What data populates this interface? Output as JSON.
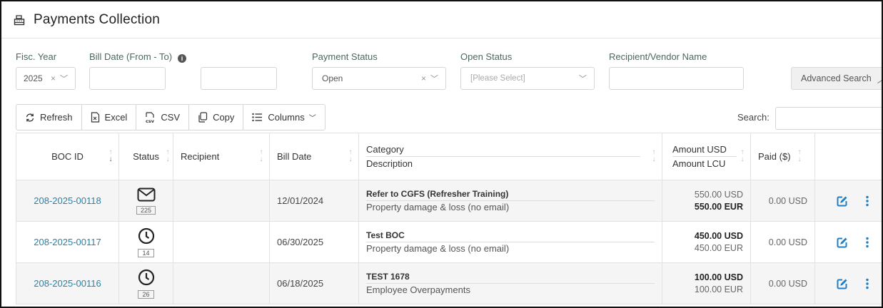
{
  "header": {
    "title": "Payments Collection",
    "icon": "cash-register-icon"
  },
  "filters": {
    "fisc_year": {
      "label": "Fisc. Year",
      "value": "2025"
    },
    "bill_date": {
      "label": "Bill Date (From - To)",
      "from": "",
      "to": ""
    },
    "payment_status": {
      "label": "Payment Status",
      "value": "Open"
    },
    "open_status": {
      "label": "Open Status",
      "placeholder": "[Please Select]"
    },
    "recipient": {
      "label": "Recipient/Vendor Name",
      "value": ""
    },
    "advanced_search": "Advanced Search"
  },
  "toolbar": {
    "refresh": "Refresh",
    "excel": "Excel",
    "csv": "CSV",
    "copy": "Copy",
    "columns": "Columns",
    "search_label": "Search:"
  },
  "table": {
    "headers": {
      "boc_id": "BOC ID",
      "status": "Status",
      "recipient": "Recipient",
      "bill_date": "Bill Date",
      "category": "Category",
      "description": "Description",
      "amount_usd": "Amount USD",
      "amount_lcu": "Amount LCU",
      "paid": "Paid ($)"
    },
    "rows": [
      {
        "boc_id": "208-2025-00118",
        "status_icon": "envelope-icon",
        "status_count": "225",
        "recipient": "",
        "bill_date": "12/01/2024",
        "category": "Refer to CGFS (Refresher Training)",
        "description": "Property damage & loss (no email)",
        "amount_usd": "550.00 USD",
        "amount_lcu": "550.00 EUR",
        "paid": "0.00 USD"
      },
      {
        "boc_id": "208-2025-00117",
        "status_icon": "clock-icon",
        "status_count": "14",
        "recipient": "",
        "bill_date": "06/30/2025",
        "category": "Test BOC",
        "description": "Property damage & loss (no email)",
        "amount_usd": "450.00 USD",
        "amount_lcu": "450.00 EUR",
        "paid": "0.00 USD"
      },
      {
        "boc_id": "208-2025-00116",
        "status_icon": "clock-icon",
        "status_count": "26",
        "recipient": "",
        "bill_date": "06/18/2025",
        "category": "TEST 1678",
        "description": "Employee Overpayments",
        "amount_usd": "100.00 USD",
        "amount_lcu": "100.00 EUR",
        "paid": "0.00 USD"
      }
    ]
  },
  "colors": {
    "link": "#2f7fa3",
    "action": "#1f7fc4",
    "label": "#4a6a5a"
  }
}
